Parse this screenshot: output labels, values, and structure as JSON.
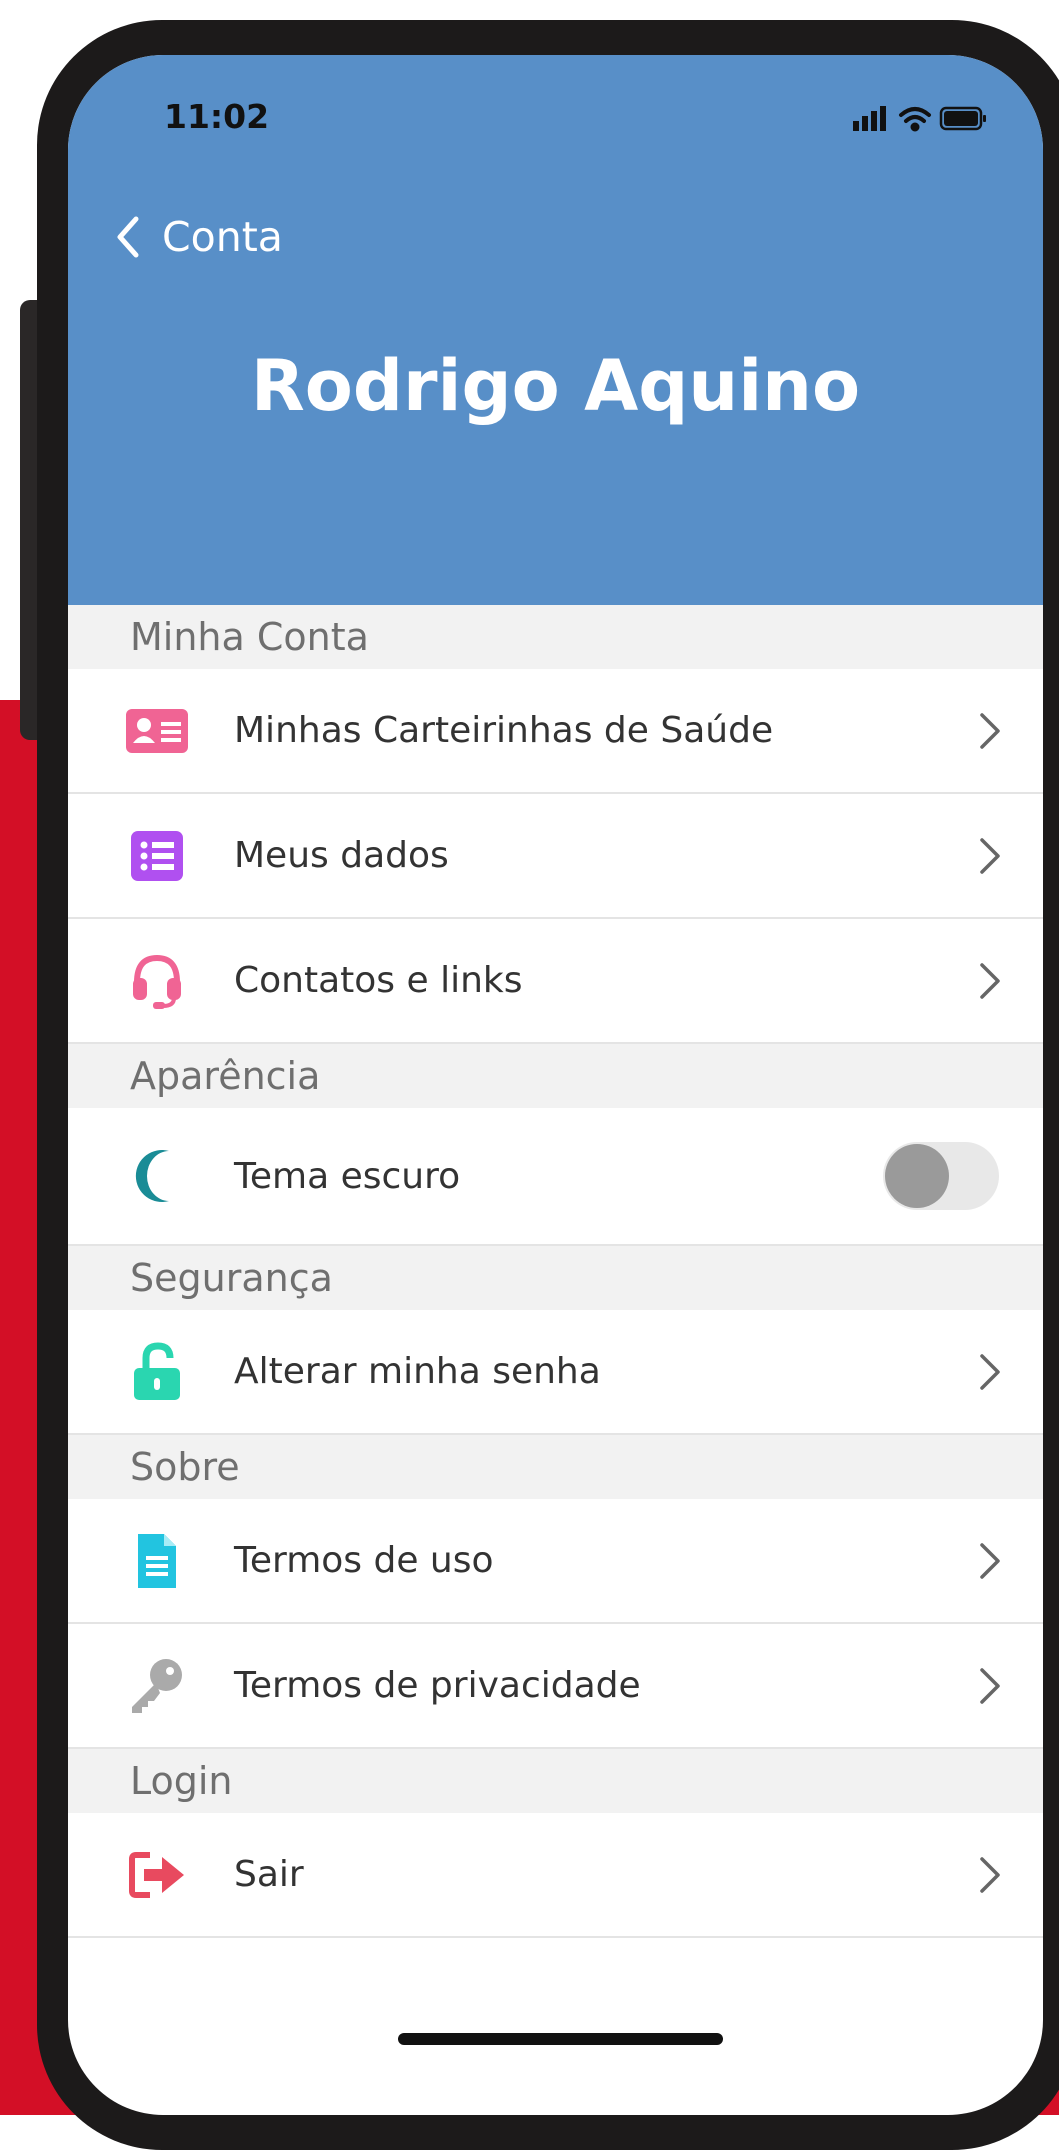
{
  "status_bar": {
    "time": "11:02"
  },
  "nav": {
    "back_label": "Conta"
  },
  "profile": {
    "name": "Rodrigo Aquino"
  },
  "sections": [
    {
      "title": "Minha Conta",
      "items": [
        {
          "label": "Minhas Carteirinhas de Saúde",
          "icon": "id-card-icon",
          "color": "#f06494"
        },
        {
          "label": "Meus dados",
          "icon": "list-icon",
          "color": "#b050f0"
        },
        {
          "label": "Contatos e links",
          "icon": "headset-icon",
          "color": "#f06494"
        }
      ]
    },
    {
      "title": "Aparência",
      "items": [
        {
          "label": "Tema escuro",
          "icon": "moon-icon",
          "color": "#1a8c96",
          "toggle": false
        }
      ]
    },
    {
      "title": "Segurança",
      "items": [
        {
          "label": "Alterar minha senha",
          "icon": "unlock-icon",
          "color": "#2ad6b0"
        }
      ]
    },
    {
      "title": "Sobre",
      "items": [
        {
          "label": "Termos de uso",
          "icon": "document-icon",
          "color": "#22c4e0"
        },
        {
          "label": "Termos de privacidade",
          "icon": "key-icon",
          "color": "#aaaaaa"
        }
      ]
    },
    {
      "title": "Login",
      "items": [
        {
          "label": "Sair",
          "icon": "sign-out-icon",
          "color": "#e84a5f"
        }
      ]
    }
  ],
  "colors": {
    "header": "#588fc8",
    "background": "#d30f26"
  }
}
